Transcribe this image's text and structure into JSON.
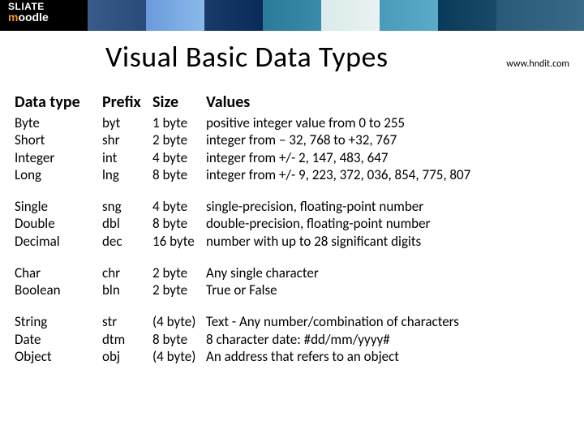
{
  "banner": {
    "logo_line1": "SLIATE",
    "logo_line2_a": "m",
    "logo_line2_b": "oodle"
  },
  "header": {
    "title": "Visual Basic Data Types",
    "url": "www.hndit.com"
  },
  "table": {
    "headers": {
      "type": "Data type",
      "prefix": "Prefix",
      "size": "Size",
      "values": "Values"
    },
    "groups": [
      [
        {
          "type": "Byte",
          "prefix": "byt",
          "size": "1 byte",
          "values": "positive integer value from 0 to 255"
        },
        {
          "type": "Short",
          "prefix": "shr",
          "size": "2 byte",
          "values": "integer from – 32, 768 to +32, 767"
        },
        {
          "type": "Integer",
          "prefix": "int",
          "size": "4 byte",
          "values": "integer from +/- 2, 147, 483, 647"
        },
        {
          "type": "Long",
          "prefix": "lng",
          "size": "8 byte",
          "values": "integer from +/- 9, 223, 372, 036, 854, 775, 807"
        }
      ],
      [
        {
          "type": "Single",
          "prefix": "sng",
          "size": "4 byte",
          "values": "single-precision, floating-point number"
        },
        {
          "type": "Double",
          "prefix": "dbl",
          "size": "8 byte",
          "values": "double-precision, floating-point number"
        },
        {
          "type": "Decimal",
          "prefix": "dec",
          "size": "16 byte",
          "values": "number with up to 28 significant digits"
        }
      ],
      [
        {
          "type": "Char",
          "prefix": "chr",
          "size": "2 byte",
          "values": "Any single character"
        },
        {
          "type": "Boolean",
          "prefix": "bln",
          "size": "2 byte",
          "values": "True or False"
        }
      ],
      [
        {
          "type": "String",
          "prefix": "str",
          "size": "(4 byte)",
          "values": "Text - Any number/combination of characters"
        },
        {
          "type": "Date",
          "prefix": "dtm",
          "size": "8 byte",
          "values": "8 character date:  #dd/mm/yyyy#"
        },
        {
          "type": "Object",
          "prefix": "obj",
          "size": "(4 byte)",
          "values": "An address that refers to an object"
        }
      ]
    ]
  }
}
